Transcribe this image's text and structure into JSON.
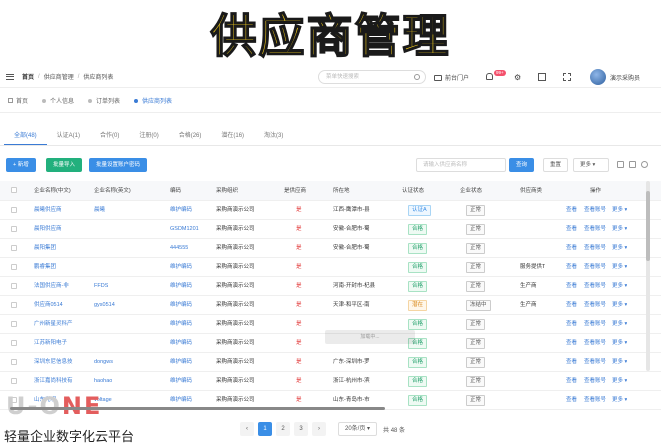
{
  "banner": {
    "title": "供应商管理"
  },
  "header": {
    "breadcrumbs": [
      "首页",
      "供应商管理",
      "供应商列表"
    ],
    "search_placeholder": "菜单快速搜索",
    "portal": "前台门户",
    "badge": "99+",
    "user": "演示采购员"
  },
  "nav_tabs": [
    "首页",
    "个人信息",
    "订单列表",
    "供应商列表"
  ],
  "status_tabs": [
    "全部(48)",
    "认证A(1)",
    "合作(0)",
    "注册(0)",
    "合格(26)",
    "潜在(16)",
    "淘汰(3)"
  ],
  "toolbar": {
    "new": "+ 新增",
    "batch_import": "批量导入",
    "batch_account": "批量设置账户密码",
    "search_placeholder": "请输入供应商名称",
    "query": "查询",
    "reset": "重置",
    "more": "更多 ▾"
  },
  "columns": [
    "企业名称(中文)",
    "企业名称(英文)",
    "编码",
    "采购组织",
    "是供应商",
    "所在地",
    "认证状态",
    "企业状态",
    "供应商类",
    "操作"
  ],
  "rows": [
    {
      "cn": "晨曦供应商",
      "en": "晨曦",
      "code": "维护编码",
      "org": "采购商演示公司",
      "is": "是",
      "loc": "江西-鹰潭市-县",
      "cert": "认证A",
      "cert_type": "blue",
      "state": "正常",
      "cat": ""
    },
    {
      "cn": "晨阳供应商",
      "en": "",
      "code": "GSDM1201",
      "org": "采购商演示公司",
      "is": "是",
      "loc": "安徽-合肥市-蜀",
      "cert": "合格",
      "cert_type": "green",
      "state": "正常",
      "cat": ""
    },
    {
      "cn": "晨阳集团",
      "en": "",
      "code": "444555",
      "org": "采购商演示公司",
      "is": "是",
      "loc": "安徽-合肥市-蜀",
      "cert": "合格",
      "cert_type": "green",
      "state": "正常",
      "cat": ""
    },
    {
      "cn": "鹏睿集团",
      "en": "",
      "code": "维护编码",
      "org": "采购商演示公司",
      "is": "是",
      "loc": "",
      "cert": "合格",
      "cert_type": "green",
      "state": "正常",
      "cat": "服务提供T"
    },
    {
      "cn": "法国供应商-非",
      "en": "FFDS",
      "code": "维护编码",
      "org": "采购商演示公司",
      "is": "是",
      "loc": "河南-开封市-杞县",
      "cert": "合格",
      "cert_type": "green",
      "state": "正常",
      "cat": "生产商"
    },
    {
      "cn": "供应商0514",
      "en": "gys0514",
      "code": "维护编码",
      "org": "采购商演示公司",
      "is": "是",
      "loc": "天津-和平区-南",
      "cert": "潜在",
      "cert_type": "orange",
      "state": "冻结中",
      "cat": "生产商"
    },
    {
      "cn": "广州新星灵科产",
      "en": "",
      "code": "维护编码",
      "org": "采购商演示公司",
      "is": "是",
      "loc": "",
      "cert": "合格",
      "cert_type": "green",
      "state": "正常",
      "cat": ""
    },
    {
      "cn": "江苏新阳电子",
      "en": "",
      "code": "维护编码",
      "org": "采购商演示公司",
      "is": "是",
      "loc": "",
      "cert": "合格",
      "cert_type": "green",
      "state": "正常",
      "cat": ""
    },
    {
      "cn": "深圳东尼信息技",
      "en": "dongws",
      "code": "维护编码",
      "org": "采购商演示公司",
      "is": "是",
      "loc": "广东-深圳市-罗",
      "cert": "合格",
      "cert_type": "green",
      "state": "正常",
      "cat": ""
    },
    {
      "cn": "浙江嘉尚科技有",
      "en": "haohao",
      "code": "维护编码",
      "org": "采购商演示公司",
      "is": "是",
      "loc": "浙江-杭州市-滨",
      "cert": "合格",
      "cert_type": "green",
      "state": "正常",
      "cat": ""
    },
    {
      "cn": "山东光明",
      "en": "voltage",
      "code": "维护编码",
      "org": "采购商演示公司",
      "is": "是",
      "loc": "山东-青岛市-市",
      "cert": "合格",
      "cert_type": "green",
      "state": "正常",
      "cat": ""
    }
  ],
  "ops": {
    "view": "查看",
    "account": "查看账号",
    "more": "更多 ▾"
  },
  "toast": "加载中...",
  "pager": {
    "pages": [
      "‹",
      "1",
      "2",
      "3",
      "›"
    ],
    "size": "20条/页 ▾",
    "total": "共 48 条"
  },
  "watermark": {
    "logo_a": "U-O",
    "logo_b": "NE",
    "text": "轻量企业数字化云平台"
  }
}
